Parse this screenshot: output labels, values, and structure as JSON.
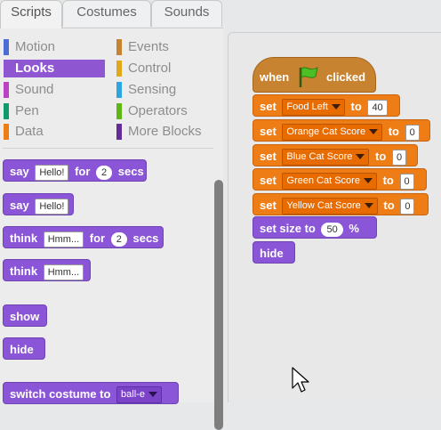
{
  "tabs": [
    {
      "label": "Scripts"
    },
    {
      "label": "Costumes"
    },
    {
      "label": "Sounds"
    }
  ],
  "categories": [
    {
      "label": "Motion",
      "color": "#4a6cd4"
    },
    {
      "label": "Looks",
      "color": "#8a55d7"
    },
    {
      "label": "Sound",
      "color": "#bb42c3"
    },
    {
      "label": "Pen",
      "color": "#0e9a6c"
    },
    {
      "label": "Data",
      "color": "#ee7d16"
    },
    {
      "label": "Events",
      "color": "#c88330"
    },
    {
      "label": "Control",
      "color": "#e1a91a"
    },
    {
      "label": "Sensing",
      "color": "#2ca5e2"
    },
    {
      "label": "Operators",
      "color": "#5cb712"
    },
    {
      "label": "More Blocks",
      "color": "#632d99"
    }
  ],
  "palette_blocks": {
    "say_for": {
      "say": "say",
      "text": "Hello!",
      "for": "for",
      "secs_value": "2",
      "secs": "secs"
    },
    "say": {
      "say": "say",
      "text": "Hello!"
    },
    "think_for": {
      "think": "think",
      "text": "Hmm...",
      "for": "for",
      "secs_value": "2",
      "secs": "secs"
    },
    "think": {
      "think": "think",
      "text": "Hmm..."
    },
    "show": "show",
    "hide": "hide",
    "switch_costume": {
      "label": "switch costume to",
      "value": "ball-e"
    }
  },
  "script": {
    "when": "when",
    "clicked": "clicked",
    "set": "set",
    "to": "to",
    "rows": [
      {
        "var": "Food Left",
        "value": "40"
      },
      {
        "var": "Orange Cat Score",
        "value": "0"
      },
      {
        "var": "Blue Cat Score",
        "value": "0"
      },
      {
        "var": "Green Cat Score",
        "value": "0"
      },
      {
        "var": "Yellow Cat Score",
        "value": "0"
      }
    ],
    "set_size": {
      "label": "set size to",
      "value": "50",
      "unit": "%"
    },
    "hide": "hide"
  }
}
